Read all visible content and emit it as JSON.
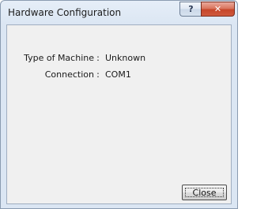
{
  "window": {
    "title": "Hardware Configuration",
    "help_glyph": "?",
    "close_glyph": "✕"
  },
  "fields": [
    {
      "label": "Type of Machine",
      "separator": ":",
      "value": "Unknown"
    },
    {
      "label": "Connection",
      "separator": ":",
      "value": "COM1"
    }
  ],
  "buttons": {
    "close_label": "Close"
  }
}
